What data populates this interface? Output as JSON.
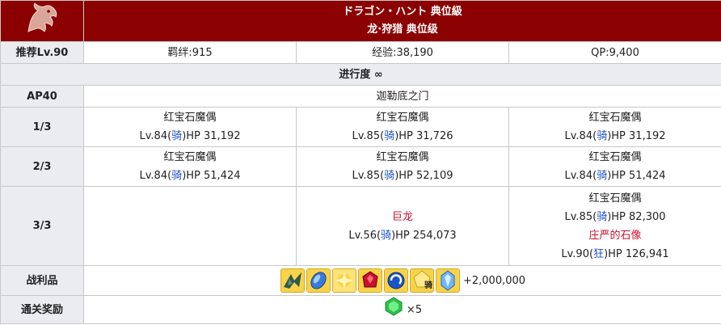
{
  "quest": {
    "title_jp": "ドラゴン・ハント 典位級",
    "title_cn": "龙·狩猎 典位级"
  },
  "info": {
    "rec_level": "推荐Lv.90",
    "bond": "羁绊:915",
    "exp": "经验:38,190",
    "qp": "QP:9,400"
  },
  "progress": "进行度 ∞",
  "ap": "AP40",
  "location": "迦勒底之门",
  "waves": [
    {
      "label": "1/3",
      "enemies": [
        {
          "lines": [
            {
              "name": "红宝石魔偶"
            },
            {
              "pre": "Lv.84(",
              "cls": "骑",
              "post": ")HP 31,192"
            }
          ]
        },
        {
          "lines": [
            {
              "name": "红宝石魔偶"
            },
            {
              "pre": "Lv.85(",
              "cls": "骑",
              "post": ")HP 31,726"
            }
          ]
        },
        {
          "lines": [
            {
              "name": "红宝石魔偶"
            },
            {
              "pre": "Lv.84(",
              "cls": "骑",
              "post": ")HP 31,192"
            }
          ]
        }
      ]
    },
    {
      "label": "2/3",
      "enemies": [
        {
          "lines": [
            {
              "name": "红宝石魔偶"
            },
            {
              "pre": "Lv.84(",
              "cls": "骑",
              "post": ")HP 51,424"
            }
          ]
        },
        {
          "lines": [
            {
              "name": "红宝石魔偶"
            },
            {
              "pre": "Lv.85(",
              "cls": "骑",
              "post": ")HP 52,109"
            }
          ]
        },
        {
          "lines": [
            {
              "name": "红宝石魔偶"
            },
            {
              "pre": "Lv.84(",
              "cls": "骑",
              "post": ")HP 51,424"
            }
          ]
        }
      ]
    },
    {
      "label": "3/3",
      "enemies": [
        {
          "lines": []
        },
        {
          "lines": [
            {
              "name": "巨龙",
              "boss": true
            },
            {
              "pre": "Lv.56(",
              "cls": "骑",
              "post": ")HP 254,073"
            }
          ]
        },
        {
          "lines": [
            {
              "name": "红宝石魔偶"
            },
            {
              "pre": "Lv.85(",
              "cls": "骑",
              "post": ")HP 82,300"
            },
            {
              "name": "庄严的石像",
              "boss": true
            },
            {
              "pre": "Lv.90(",
              "cls": "狂",
              "post": ")HP 126,941"
            }
          ]
        }
      ]
    }
  ],
  "drops": {
    "label": "战利品",
    "icons": [
      {
        "name": "dragon-wing-icon",
        "badge": ""
      },
      {
        "name": "blue-scale-icon",
        "badge": ""
      },
      {
        "name": "golden-spark-icon",
        "badge": ""
      },
      {
        "name": "red-gem-icon",
        "badge": ""
      },
      {
        "name": "blue-orb-icon",
        "badge": ""
      },
      {
        "name": "rider-piece-icon",
        "badge": "骑"
      },
      {
        "name": "blue-crystal-icon",
        "badge": ""
      }
    ],
    "extra": "+2,000,000"
  },
  "clear": {
    "label": "通关奖励",
    "icon": "green-gem-icon",
    "count": "×5"
  },
  "colors": {
    "header_bg": "#8b0000",
    "row_header_bg": "#eaecf0",
    "class_blue": "#1a50c8",
    "boss_red": "#c8102e"
  }
}
